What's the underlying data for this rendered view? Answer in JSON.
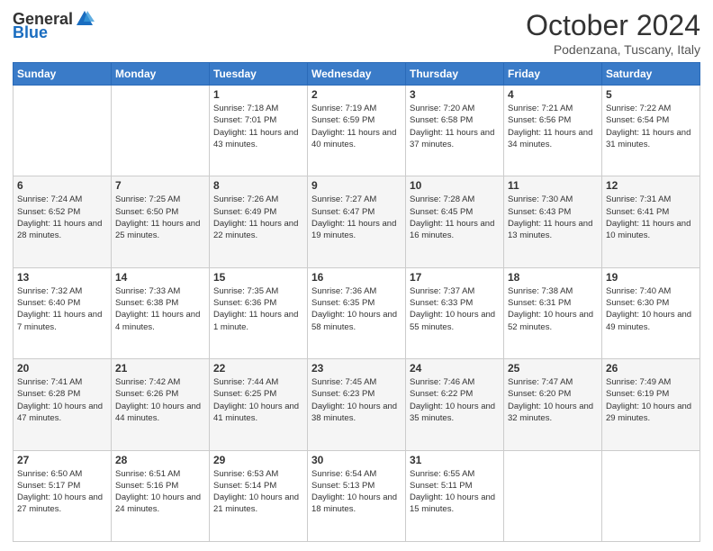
{
  "header": {
    "logo_general": "General",
    "logo_blue": "Blue",
    "month_title": "October 2024",
    "location": "Podenzana, Tuscany, Italy"
  },
  "days_of_week": [
    "Sunday",
    "Monday",
    "Tuesday",
    "Wednesday",
    "Thursday",
    "Friday",
    "Saturday"
  ],
  "weeks": [
    [
      {
        "day": "",
        "info": ""
      },
      {
        "day": "",
        "info": ""
      },
      {
        "day": "1",
        "info": "Sunrise: 7:18 AM\nSunset: 7:01 PM\nDaylight: 11 hours and 43 minutes."
      },
      {
        "day": "2",
        "info": "Sunrise: 7:19 AM\nSunset: 6:59 PM\nDaylight: 11 hours and 40 minutes."
      },
      {
        "day": "3",
        "info": "Sunrise: 7:20 AM\nSunset: 6:58 PM\nDaylight: 11 hours and 37 minutes."
      },
      {
        "day": "4",
        "info": "Sunrise: 7:21 AM\nSunset: 6:56 PM\nDaylight: 11 hours and 34 minutes."
      },
      {
        "day": "5",
        "info": "Sunrise: 7:22 AM\nSunset: 6:54 PM\nDaylight: 11 hours and 31 minutes."
      }
    ],
    [
      {
        "day": "6",
        "info": "Sunrise: 7:24 AM\nSunset: 6:52 PM\nDaylight: 11 hours and 28 minutes."
      },
      {
        "day": "7",
        "info": "Sunrise: 7:25 AM\nSunset: 6:50 PM\nDaylight: 11 hours and 25 minutes."
      },
      {
        "day": "8",
        "info": "Sunrise: 7:26 AM\nSunset: 6:49 PM\nDaylight: 11 hours and 22 minutes."
      },
      {
        "day": "9",
        "info": "Sunrise: 7:27 AM\nSunset: 6:47 PM\nDaylight: 11 hours and 19 minutes."
      },
      {
        "day": "10",
        "info": "Sunrise: 7:28 AM\nSunset: 6:45 PM\nDaylight: 11 hours and 16 minutes."
      },
      {
        "day": "11",
        "info": "Sunrise: 7:30 AM\nSunset: 6:43 PM\nDaylight: 11 hours and 13 minutes."
      },
      {
        "day": "12",
        "info": "Sunrise: 7:31 AM\nSunset: 6:41 PM\nDaylight: 11 hours and 10 minutes."
      }
    ],
    [
      {
        "day": "13",
        "info": "Sunrise: 7:32 AM\nSunset: 6:40 PM\nDaylight: 11 hours and 7 minutes."
      },
      {
        "day": "14",
        "info": "Sunrise: 7:33 AM\nSunset: 6:38 PM\nDaylight: 11 hours and 4 minutes."
      },
      {
        "day": "15",
        "info": "Sunrise: 7:35 AM\nSunset: 6:36 PM\nDaylight: 11 hours and 1 minute."
      },
      {
        "day": "16",
        "info": "Sunrise: 7:36 AM\nSunset: 6:35 PM\nDaylight: 10 hours and 58 minutes."
      },
      {
        "day": "17",
        "info": "Sunrise: 7:37 AM\nSunset: 6:33 PM\nDaylight: 10 hours and 55 minutes."
      },
      {
        "day": "18",
        "info": "Sunrise: 7:38 AM\nSunset: 6:31 PM\nDaylight: 10 hours and 52 minutes."
      },
      {
        "day": "19",
        "info": "Sunrise: 7:40 AM\nSunset: 6:30 PM\nDaylight: 10 hours and 49 minutes."
      }
    ],
    [
      {
        "day": "20",
        "info": "Sunrise: 7:41 AM\nSunset: 6:28 PM\nDaylight: 10 hours and 47 minutes."
      },
      {
        "day": "21",
        "info": "Sunrise: 7:42 AM\nSunset: 6:26 PM\nDaylight: 10 hours and 44 minutes."
      },
      {
        "day": "22",
        "info": "Sunrise: 7:44 AM\nSunset: 6:25 PM\nDaylight: 10 hours and 41 minutes."
      },
      {
        "day": "23",
        "info": "Sunrise: 7:45 AM\nSunset: 6:23 PM\nDaylight: 10 hours and 38 minutes."
      },
      {
        "day": "24",
        "info": "Sunrise: 7:46 AM\nSunset: 6:22 PM\nDaylight: 10 hours and 35 minutes."
      },
      {
        "day": "25",
        "info": "Sunrise: 7:47 AM\nSunset: 6:20 PM\nDaylight: 10 hours and 32 minutes."
      },
      {
        "day": "26",
        "info": "Sunrise: 7:49 AM\nSunset: 6:19 PM\nDaylight: 10 hours and 29 minutes."
      }
    ],
    [
      {
        "day": "27",
        "info": "Sunrise: 6:50 AM\nSunset: 5:17 PM\nDaylight: 10 hours and 27 minutes."
      },
      {
        "day": "28",
        "info": "Sunrise: 6:51 AM\nSunset: 5:16 PM\nDaylight: 10 hours and 24 minutes."
      },
      {
        "day": "29",
        "info": "Sunrise: 6:53 AM\nSunset: 5:14 PM\nDaylight: 10 hours and 21 minutes."
      },
      {
        "day": "30",
        "info": "Sunrise: 6:54 AM\nSunset: 5:13 PM\nDaylight: 10 hours and 18 minutes."
      },
      {
        "day": "31",
        "info": "Sunrise: 6:55 AM\nSunset: 5:11 PM\nDaylight: 10 hours and 15 minutes."
      },
      {
        "day": "",
        "info": ""
      },
      {
        "day": "",
        "info": ""
      }
    ]
  ]
}
